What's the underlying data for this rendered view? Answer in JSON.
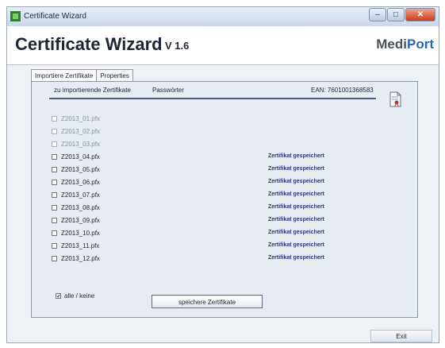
{
  "window": {
    "title": "Certificate Wizard",
    "buttons": {
      "minimize": "–",
      "maximize": "□",
      "close": "✕"
    }
  },
  "header": {
    "title": "Certificate Wizard",
    "version": "V 1.6",
    "brand_part1": "Medi",
    "brand_part2": "Port"
  },
  "tabs": [
    {
      "label": "Importiere Zertifikate",
      "active": true
    },
    {
      "label": "Properties",
      "active": false
    }
  ],
  "table": {
    "col_certs": "zu importierende Zertifikate",
    "col_passwords": "Passwörter",
    "ean": "EAN: 7601001368583",
    "rows": [
      {
        "file": "Z2013_01.pfx",
        "status": "",
        "enabled": false
      },
      {
        "file": "Z2013_02.pfx",
        "status": "",
        "enabled": false
      },
      {
        "file": "Z2013_03.pfx",
        "status": "",
        "enabled": false
      },
      {
        "file": "Z2013_04.pfx",
        "status": "Zertifikat gespeichert",
        "enabled": true
      },
      {
        "file": "Z2013_05.pfx",
        "status": "Zertifikat gespeichert",
        "enabled": true
      },
      {
        "file": "Z2013_06.pfx",
        "status": "Zertifikat gespeichert",
        "enabled": true
      },
      {
        "file": "Z2013_07.pfx",
        "status": "Zertifikat gespeichert",
        "enabled": true
      },
      {
        "file": "Z2013_08.pfx",
        "status": "Zertifikat gespeichert",
        "enabled": true
      },
      {
        "file": "Z2013_09.pfx",
        "status": "Zertifikat gespeichert",
        "enabled": true
      },
      {
        "file": "Z2013_10.pfx",
        "status": "Zertifikat gespeichert",
        "enabled": true
      },
      {
        "file": "Z2013_11.pfx",
        "status": "Zertifikat gespeichert",
        "enabled": true
      },
      {
        "file": "Z2013_12.pfx",
        "status": "Zertifikat gespeichert",
        "enabled": true
      }
    ]
  },
  "select_all": {
    "label": "alle / keine",
    "checked": true
  },
  "save_button": "speichere Zertifikate",
  "exit_button": "Exit",
  "colors": {
    "accent": "#2a66b8",
    "rule": "#4d5a86",
    "status": "#2f3a7c"
  }
}
